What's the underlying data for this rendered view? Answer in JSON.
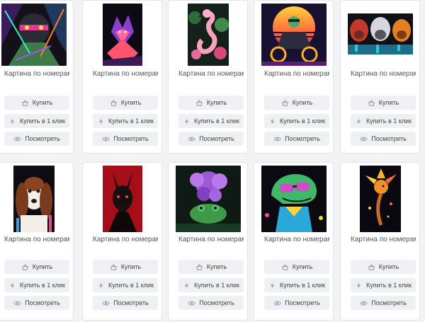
{
  "products": [
    {
      "title": "Картина по номерам Strateg...",
      "image": "ninja-neon-art"
    },
    {
      "title": "Картина по номерам Strateg...",
      "image": "fox-neon-art"
    },
    {
      "title": "Картина по номерам Strateg...",
      "image": "flamingo-art"
    },
    {
      "title": "Картина по номерам Strateg...",
      "image": "biker-sunset-art"
    },
    {
      "title": "Картина по номерам Strateg...",
      "image": "three-apes-art"
    },
    {
      "title": "Картина по номерам Strateg...",
      "image": "spaniel-dog-art"
    },
    {
      "title": "Картина по номерам Strateg...",
      "image": "doberman-red-art"
    },
    {
      "title": "Картина по номерам Strateg...",
      "image": "frog-lilac-art"
    },
    {
      "title": "Картина по номерам Strateg...",
      "image": "lizard-sunglasses-art"
    },
    {
      "title": "Картина по номерам Strateg...",
      "image": "fire-bird-art"
    }
  ],
  "buttons": {
    "buy": "Купить",
    "buy_one_click": "Купить в 1 клик",
    "view": "Посмотреть"
  },
  "icons": {
    "buy": "basket-icon",
    "buy_one_click": "lightning-icon",
    "view": "eye-icon"
  },
  "colors": {
    "card_bg": "#ffffff",
    "button_bg": "#eef0f3",
    "page_bg": "#f2f3f5",
    "icon": "#9aa0a8"
  }
}
